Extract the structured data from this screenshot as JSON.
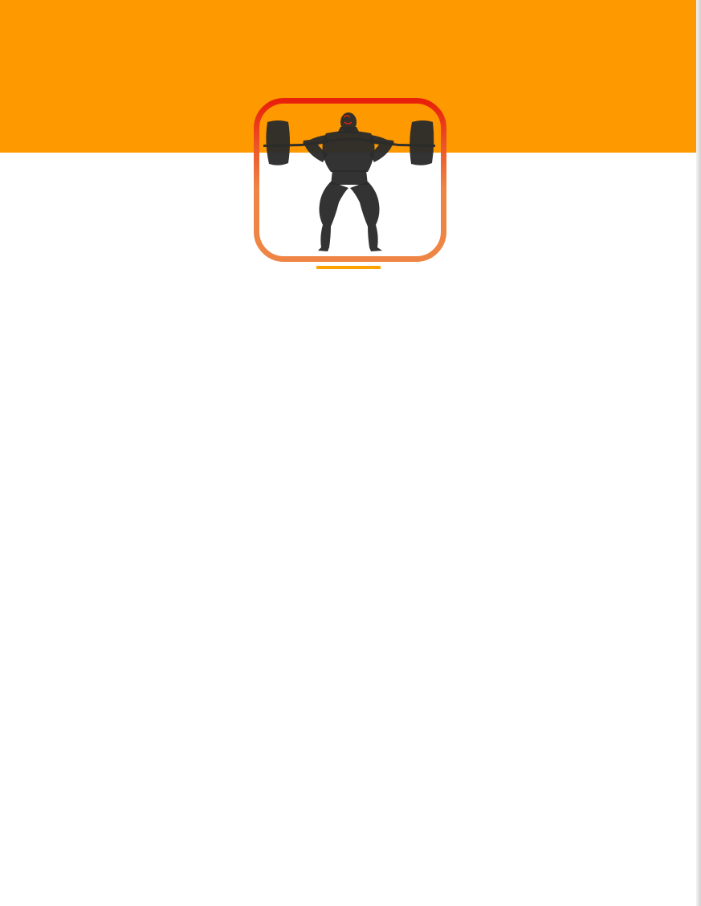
{
  "theme": {
    "header_color": "#FF9900",
    "badge_border_top": "#E8200A",
    "badge_border_bottom": "#EE8544",
    "silhouette_color": "#2B2B2B",
    "underline_color": "#FFA200",
    "page_background": "#FFFFFF"
  },
  "logo": {
    "icon": "weightlifter-squat-icon"
  }
}
